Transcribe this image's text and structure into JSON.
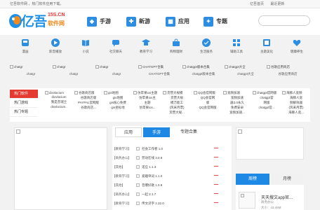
{
  "topbar": {
    "left_text": "亿吾软件网 ，热门软件应用下载。",
    "links": [
      "亿吾首页",
      "最近更新"
    ]
  },
  "logo": {
    "text": "亿吾",
    "domain": "15S.CN",
    "subtitle": "软件网"
  },
  "nav": [
    {
      "label": "手游",
      "icon": "gamepad-icon"
    },
    {
      "label": "新游",
      "icon": "new-game-icon"
    },
    {
      "label": "应用",
      "icon": "apps-icon"
    },
    {
      "label": "专题",
      "icon": "topic-icon"
    }
  ],
  "search": {
    "placeholder": ""
  },
  "categories": [
    {
      "label": "漫画",
      "icon": "comic-icon"
    },
    {
      "label": "影音播放",
      "icon": "video-player-icon"
    },
    {
      "label": "小说",
      "icon": "novel-icon"
    },
    {
      "label": "社交聊天",
      "icon": "chat-icon"
    },
    {
      "label": "教育学习",
      "icon": "education-icon"
    },
    {
      "label": "购物理财",
      "icon": "shopping-icon"
    },
    {
      "label": "生活服务",
      "icon": "life-service-icon"
    },
    {
      "label": "辅助工具",
      "icon": "tools-icon"
    },
    {
      "label": "主题美化",
      "icon": "theme-icon"
    },
    {
      "label": "健康养生",
      "icon": "health-icon"
    }
  ],
  "software_row": [
    {
      "img": "chatgr",
      "label": "chatgr"
    },
    {
      "img": "chatgr",
      "label": "chatgr"
    },
    {
      "img": "chatgr",
      "label": "chatgr"
    },
    {
      "img": "CHATGPT合集",
      "label": "CHATGPT合集"
    },
    {
      "img": "chatgpt版本合集",
      "label": "chatgpt版本合集"
    },
    {
      "img": "chatgpt大全",
      "label": "chatgpt大全"
    },
    {
      "img": "谷歌应用商店",
      "label": "谷歌应用商店"
    }
  ],
  "panel": {
    "tabs": [
      "热门软件",
      "热门游戏",
      "热门专题"
    ],
    "active_tab": 0,
    "items": [
      {
        "img": "dixvlacium",
        "lines": [
          "dixvlacium",
          "我是普瑞士",
          "dixvlacium.."
        ]
      },
      {
        "img": "谷歌商店版",
        "lines": [
          "谷歌商店版",
          "PAYPAL官网版",
          "谷歌商店..."
        ]
      },
      {
        "img": "gis地图",
        "lines": [
          "gis地图",
          "gis核心免费",
          "gis坐标地"
        ]
      },
      {
        "img": "仿苹果ios主题",
        "lines": [
          "仿苹果ios主",
          "主题",
          "仿苹果ios..."
        ]
      },
      {
        "img": "货营大规模",
        "lines": [
          "货营大规",
          "模万能工",
          "(风采月票)",
          "货营大规..."
        ]
      },
      {
        "img": "QQ会官网版",
        "lines": [
          "QQ会官网",
          "版",
          "QQ会官网版"
        ]
      },
      {
        "img": "宽频加速",
        "lines": [
          "宽频加速",
          "器3.0永久",
          "免费安卓",
          "宽频加速..."
        ]
      },
      {
        "img": "chatgpt官网版",
        "lines": [
          "chatgpt官",
          "网版",
          "chatgpt官..."
        ]
      },
      {
        "img": "海豚人宽频",
        "lines": [
          "海豚人宽",
          "频解效器",
          "(风采月票)",
          "海豚人宽..."
        ]
      }
    ]
  },
  "midbox": {
    "tabs": [
      "应用",
      "手游",
      "专题合集"
    ],
    "active_tab": 1,
    "rows": [
      {
        "tag": "【教育学习】",
        "name": "社会工作者 1.0"
      },
      {
        "tag": "【商务办公】",
        "name": "劳动在线 3.0.9"
      },
      {
        "tag": "【其他】",
        "name": "诺应 1.1.3"
      },
      {
        "tag": "【教育学习】",
        "name": "爱趣单词 1.1.0"
      },
      {
        "tag": "【其他】",
        "name": "音爆好歌 1.0.9"
      },
      {
        "tag": "【商务办公】",
        "name": "一起 2.1.7"
      },
      {
        "tag": "【教育学习】",
        "name": "传文识字 2.32.0"
      }
    ]
  },
  "hotbox": {
    "tabs": [
      "周榜",
      "月榜"
    ],
    "active_tab": 0,
    "item": {
      "name": "天天搜文app官...",
      "category": "商务办公",
      "size": "大小：43.46M"
    }
  },
  "colors": {
    "brand_blue": "#1e88e5",
    "accent_red": "#e53a31",
    "logo_orange": "#f28a1b"
  }
}
